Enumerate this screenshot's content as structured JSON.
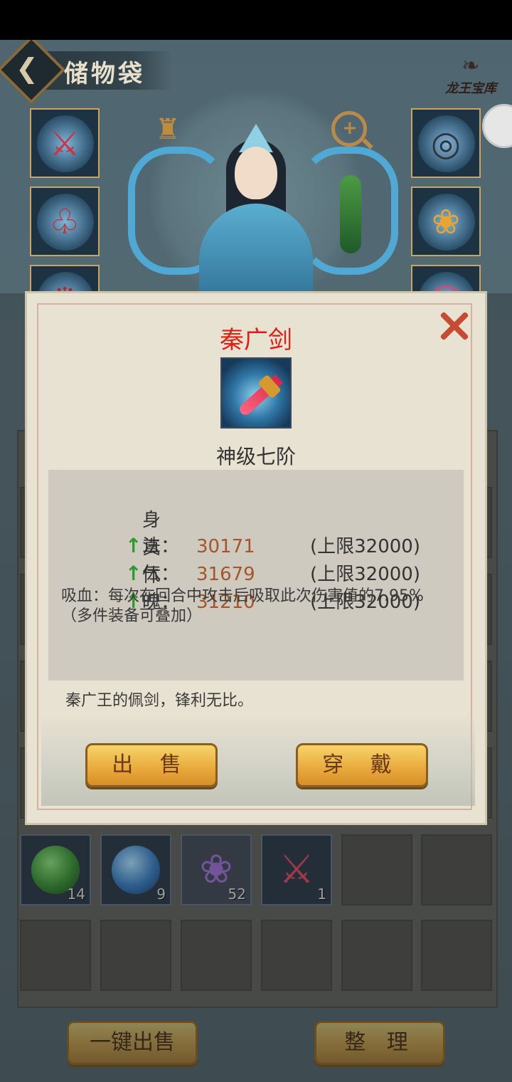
{
  "header": {
    "title": "储物袋",
    "logo_text": "龙王宝库"
  },
  "equipment_left": [
    {
      "icon": "sword-icon",
      "color": "#d03040"
    },
    {
      "icon": "armor-icon",
      "color": "#c02a2a"
    },
    {
      "icon": "helmet-icon",
      "color": "#b02828"
    }
  ],
  "equipment_right": [
    {
      "icon": "bracelet-icon",
      "color": "#444"
    },
    {
      "icon": "pendant-icon",
      "color": "#e8a532"
    },
    {
      "icon": "ring-icon",
      "color": "#d24a7a"
    }
  ],
  "bag": {
    "items": [
      {
        "icon": "green-orb-icon",
        "qty": "14"
      },
      {
        "icon": "blue-orb-icon",
        "qty": "9"
      },
      {
        "icon": "lotus-icon",
        "qty": "52"
      },
      {
        "icon": "sword-icon",
        "qty": "1"
      }
    ]
  },
  "footer": {
    "sell_all_label": "一键出售",
    "sort_label": "整 理"
  },
  "popup": {
    "name": "秦广剑",
    "grade": "神级七阶",
    "stats": [
      {
        "label": "身法：",
        "value": "30171",
        "cap": "(上限32000)"
      },
      {
        "label": "真气：",
        "value": "31679",
        "cap": "(上限32000)"
      },
      {
        "label": "体魄：",
        "value": "31210",
        "cap": "(上限32000)"
      }
    ],
    "effect": "吸血：每次在回合中攻击后吸取此次伤害值的7.95%",
    "effect_note": "（多件装备可叠加）",
    "description": "秦广王的佩剑，锋利无比。",
    "sell_label": "出 售",
    "equip_label": "穿 戴"
  },
  "colors": {
    "name_red": "#e01e12",
    "value_brown": "#a3562a",
    "arrow_green": "#2c9a2c",
    "button_gold": "#e9a83b"
  }
}
